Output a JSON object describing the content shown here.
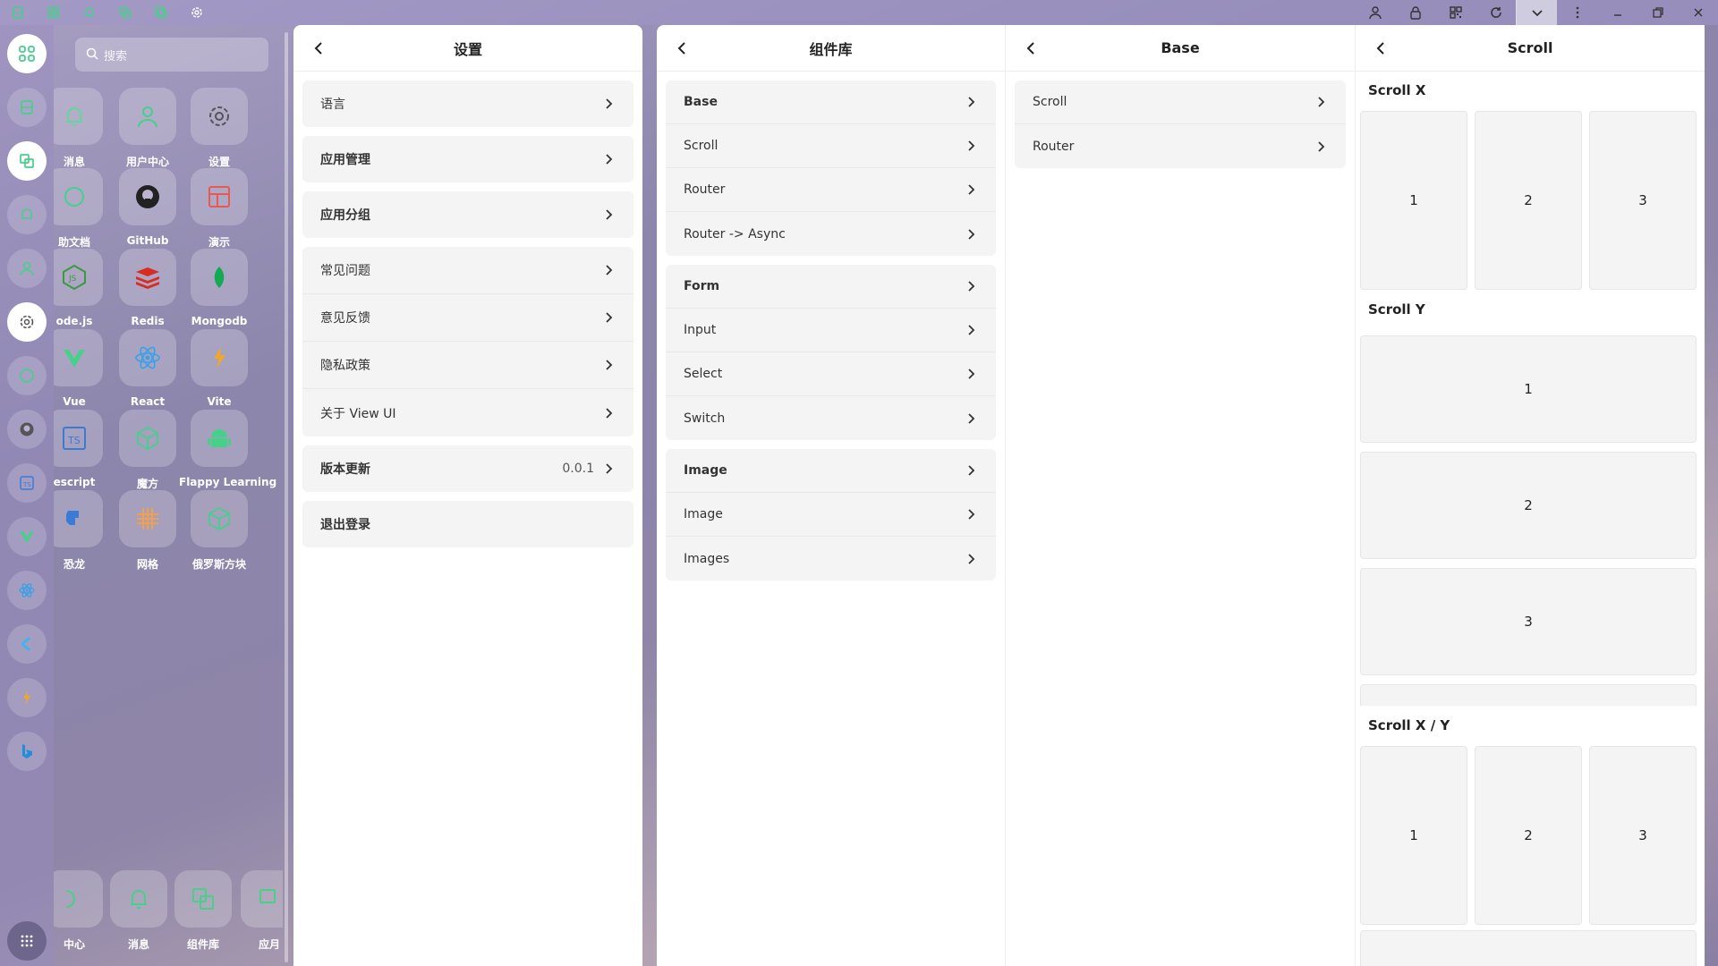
{
  "topbar": {
    "left_icons": [
      "sheet-icon",
      "grid-icon",
      "bell-icon",
      "copy-icon",
      "stack-icon",
      "gear-icon"
    ],
    "right_icons": [
      "user-icon",
      "lock-icon",
      "qrcode-icon",
      "refresh-icon",
      "chevron-down-icon",
      "more-icon",
      "minimize-icon",
      "restore-icon",
      "close-icon"
    ]
  },
  "launcher": {
    "search_placeholder": "搜索",
    "apps": [
      {
        "label": "消息",
        "icon": "bell-icon"
      },
      {
        "label": "用户中心",
        "icon": "user-icon"
      },
      {
        "label": "设置",
        "icon": "gear-icon"
      },
      {
        "label": "助文档",
        "icon": "doc-icon"
      },
      {
        "label": "GitHub",
        "icon": "github-icon"
      },
      {
        "label": "演示",
        "icon": "layout-icon"
      },
      {
        "label": "ode.js",
        "icon": "nodejs-icon"
      },
      {
        "label": "Redis",
        "icon": "redis-icon"
      },
      {
        "label": "Mongodb",
        "icon": "mongodb-icon"
      },
      {
        "label": "Vue",
        "icon": "vue-icon"
      },
      {
        "label": "React",
        "icon": "react-icon"
      },
      {
        "label": "Vite",
        "icon": "vite-icon"
      },
      {
        "label": "escript",
        "icon": "typescript-icon"
      },
      {
        "label": "魔方",
        "icon": "cube-icon"
      },
      {
        "label": "Flappy Learning",
        "icon": "android-icon"
      },
      {
        "label": "恐龙",
        "icon": "dino-icon"
      },
      {
        "label": "网格",
        "icon": "grid-icon"
      },
      {
        "label": "俄罗斯方块",
        "icon": "cube-icon"
      }
    ],
    "taskbar": [
      {
        "label": "中心",
        "icon": "user-icon"
      },
      {
        "label": "消息",
        "icon": "bell-icon"
      },
      {
        "label": "组件库",
        "icon": "copy-icon"
      },
      {
        "label": "应月",
        "icon": "app-icon"
      }
    ]
  },
  "settings": {
    "title": "设置",
    "groups": [
      [
        {
          "label": "语言"
        }
      ],
      [
        {
          "label": "应用管理"
        }
      ],
      [
        {
          "label": "应用分组"
        }
      ],
      [
        {
          "label": "常见问题"
        },
        {
          "label": "意见反馈"
        },
        {
          "label": "隐私政策"
        },
        {
          "label": "关于 View UI"
        }
      ],
      [
        {
          "label": "版本更新",
          "value": "0.0.1"
        }
      ],
      [
        {
          "label": "退出登录"
        }
      ]
    ]
  },
  "components": {
    "title": "组件库",
    "groups": [
      {
        "header": "Base",
        "items": [
          "Scroll",
          "Router",
          "Router -> Async"
        ]
      },
      {
        "header": "Form",
        "items": [
          "Input",
          "Select",
          "Switch"
        ]
      },
      {
        "header": "Image",
        "items": [
          "Image",
          "Images"
        ]
      }
    ]
  },
  "base": {
    "title": "Base",
    "items": [
      "Scroll",
      "Router"
    ]
  },
  "scroll": {
    "title": "Scroll",
    "scroll_x": {
      "label": "Scroll X",
      "cells": [
        "1",
        "2",
        "3"
      ]
    },
    "scroll_y": {
      "label": "Scroll Y",
      "cells": [
        "1",
        "2",
        "3"
      ]
    },
    "scroll_xy": {
      "label": "Scroll X / Y",
      "cells": [
        "1",
        "2",
        "3"
      ]
    }
  }
}
